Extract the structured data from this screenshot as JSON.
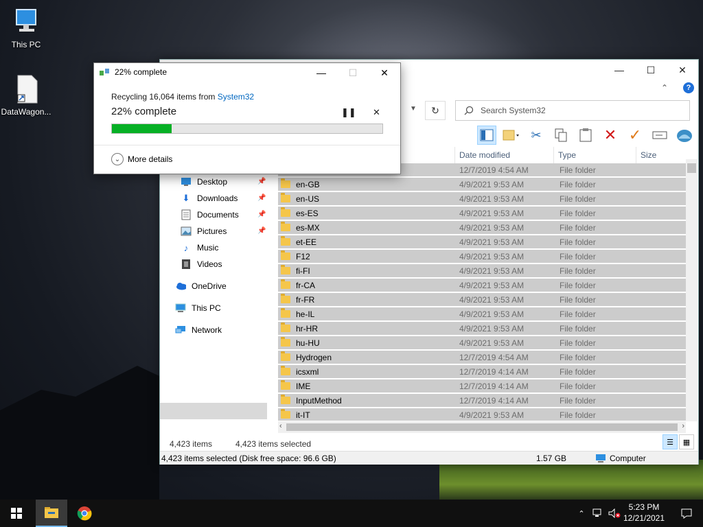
{
  "desktop": {
    "icons": [
      {
        "label": "This PC",
        "icon": "computer-icon"
      },
      {
        "label": "DataWagon...",
        "icon": "document-shortcut-icon"
      }
    ]
  },
  "explorer": {
    "controls": {
      "minimize": "—",
      "maximize": "☐",
      "close": "✕"
    },
    "search_placeholder": "Search System32",
    "columns": [
      "Date modified",
      "Type",
      "Size"
    ],
    "nav": [
      {
        "label": "Desktop",
        "icon": "desktop-icon",
        "pinned": true
      },
      {
        "label": "Downloads",
        "icon": "download-icon",
        "pinned": true
      },
      {
        "label": "Documents",
        "icon": "documents-icon",
        "pinned": true
      },
      {
        "label": "Pictures",
        "icon": "pictures-icon",
        "pinned": true
      },
      {
        "label": "Music",
        "icon": "music-icon",
        "pinned": false
      },
      {
        "label": "Videos",
        "icon": "videos-icon",
        "pinned": false
      },
      {
        "label": "OneDrive",
        "icon": "cloud-icon",
        "pinned": false
      },
      {
        "label": "This PC",
        "icon": "computer-icon",
        "pinned": false
      },
      {
        "label": "Network",
        "icon": "network-icon",
        "pinned": false
      }
    ],
    "files": [
      {
        "name": "",
        "date": "12/7/2019 4:54 AM",
        "type": "File folder"
      },
      {
        "name": "en-GB",
        "date": "4/9/2021 9:53 AM",
        "type": "File folder"
      },
      {
        "name": "en-US",
        "date": "4/9/2021 9:53 AM",
        "type": "File folder"
      },
      {
        "name": "es-ES",
        "date": "4/9/2021 9:53 AM",
        "type": "File folder"
      },
      {
        "name": "es-MX",
        "date": "4/9/2021 9:53 AM",
        "type": "File folder"
      },
      {
        "name": "et-EE",
        "date": "4/9/2021 9:53 AM",
        "type": "File folder"
      },
      {
        "name": "F12",
        "date": "4/9/2021 9:53 AM",
        "type": "File folder"
      },
      {
        "name": "fi-FI",
        "date": "4/9/2021 9:53 AM",
        "type": "File folder"
      },
      {
        "name": "fr-CA",
        "date": "4/9/2021 9:53 AM",
        "type": "File folder"
      },
      {
        "name": "fr-FR",
        "date": "4/9/2021 9:53 AM",
        "type": "File folder"
      },
      {
        "name": "he-IL",
        "date": "4/9/2021 9:53 AM",
        "type": "File folder"
      },
      {
        "name": "hr-HR",
        "date": "4/9/2021 9:53 AM",
        "type": "File folder"
      },
      {
        "name": "hu-HU",
        "date": "4/9/2021 9:53 AM",
        "type": "File folder"
      },
      {
        "name": "Hydrogen",
        "date": "12/7/2019 4:54 AM",
        "type": "File folder"
      },
      {
        "name": "icsxml",
        "date": "12/7/2019 4:14 AM",
        "type": "File folder"
      },
      {
        "name": "IME",
        "date": "12/7/2019 4:14 AM",
        "type": "File folder"
      },
      {
        "name": "InputMethod",
        "date": "12/7/2019 4:14 AM",
        "type": "File folder"
      },
      {
        "name": "it-IT",
        "date": "4/9/2021 9:53 AM",
        "type": "File folder"
      }
    ],
    "status_items": "4,423 items",
    "status_selected": "4,423 items selected",
    "details_selected": "4,423 items selected (Disk free space: 96.6 GB)",
    "details_size": "1.57 GB",
    "details_location": "Computer"
  },
  "dialog": {
    "title": "22% complete",
    "line1_prefix": "Recycling 16,064 items from ",
    "line1_link": "System32",
    "percent_text": "22% complete",
    "progress": 0.22,
    "more_details": "More details",
    "pause_label": "❚❚",
    "cancel_label": "✕"
  },
  "taskbar": {
    "time": "5:23 PM",
    "date": "12/21/2021"
  },
  "colors": {
    "progress_green": "#06b025",
    "link_blue": "#0067c0",
    "selection_gray": "#cccccc"
  }
}
